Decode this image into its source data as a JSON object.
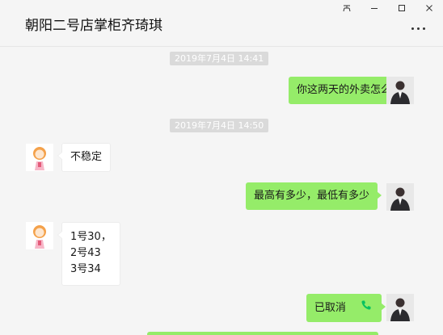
{
  "window": {
    "controls": {
      "pin": "个",
      "minimize_label": "minimize",
      "maximize_label": "maximize",
      "close_label": "close"
    }
  },
  "chat": {
    "title": "朝阳二号店掌柜齐琦琪",
    "more_icon": "more-horizontal-icon"
  },
  "messages": [
    {
      "type": "timestamp",
      "text": "2019年7月4日 14:41"
    },
    {
      "type": "text",
      "from": "me",
      "text": "你这两天的外卖怎么样"
    },
    {
      "type": "timestamp",
      "text": "2019年7月4日 14:50"
    },
    {
      "type": "text",
      "from": "other",
      "text": "不稳定"
    },
    {
      "type": "text",
      "from": "me",
      "text": "最高有多少，最低有多少"
    },
    {
      "type": "text",
      "from": "other",
      "lines": [
        "1号30，",
        "2号43",
        "3号34"
      ]
    },
    {
      "type": "call",
      "from": "me",
      "text": "已取消",
      "icon": "phone-icon"
    }
  ],
  "colors": {
    "my_bubble": "#95ec69",
    "their_bubble": "#ffffff",
    "background": "#f5f5f5",
    "timestamp_bg": "#dadada",
    "phone_icon": "#07c160"
  }
}
